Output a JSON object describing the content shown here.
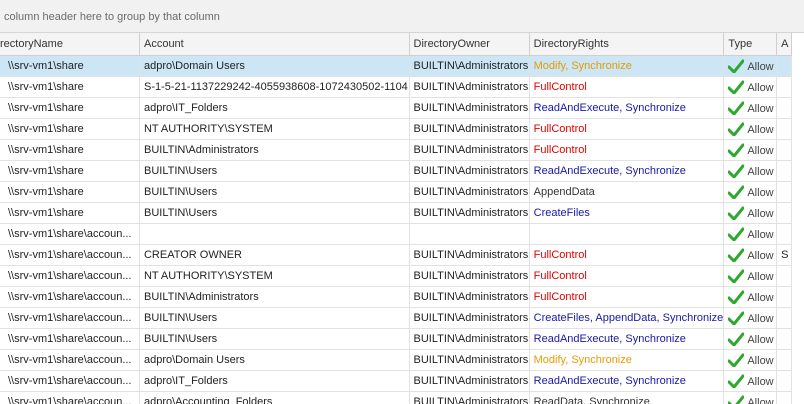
{
  "group_panel": {
    "hint": "column header here to group by that column"
  },
  "columns": [
    "rectoryName",
    "Account",
    "DirectoryOwner",
    "DirectoryRights",
    "Type",
    "A"
  ],
  "colors": {
    "selected_row": "#cce6f5",
    "rights_modify": "#e69a00",
    "rights_full": "#e00000",
    "rights_read": "#1818a8",
    "check": "#2ea82e"
  },
  "rows": [
    {
      "name": "\\\\srv-vm1\\share",
      "account": "adpro\\Domain Users",
      "owner": "BUILTIN\\Administrators",
      "rights": "Modify, Synchronize",
      "rights_kind": "mod",
      "type": "Allow",
      "extra": ""
    },
    {
      "name": "\\\\srv-vm1\\share",
      "account": "S-1-5-21-1137229242-4055938608-1072430502-1104",
      "owner": "BUILTIN\\Administrators",
      "rights": "FullControl",
      "rights_kind": "full",
      "type": "Allow",
      "extra": ""
    },
    {
      "name": "\\\\srv-vm1\\share",
      "account": "adpro\\IT_Folders",
      "owner": "BUILTIN\\Administrators",
      "rights": "ReadAndExecute, Synchronize",
      "rights_kind": "read",
      "type": "Allow",
      "extra": ""
    },
    {
      "name": "\\\\srv-vm1\\share",
      "account": "NT AUTHORITY\\SYSTEM",
      "owner": "BUILTIN\\Administrators",
      "rights": "FullControl",
      "rights_kind": "full",
      "type": "Allow",
      "extra": ""
    },
    {
      "name": "\\\\srv-vm1\\share",
      "account": "BUILTIN\\Administrators",
      "owner": "BUILTIN\\Administrators",
      "rights": "FullControl",
      "rights_kind": "full",
      "type": "Allow",
      "extra": ""
    },
    {
      "name": "\\\\srv-vm1\\share",
      "account": "BUILTIN\\Users",
      "owner": "BUILTIN\\Administrators",
      "rights": "ReadAndExecute, Synchronize",
      "rights_kind": "read",
      "type": "Allow",
      "extra": ""
    },
    {
      "name": "\\\\srv-vm1\\share",
      "account": "BUILTIN\\Users",
      "owner": "BUILTIN\\Administrators",
      "rights": "AppendData",
      "rights_kind": "plain",
      "type": "Allow",
      "extra": ""
    },
    {
      "name": "\\\\srv-vm1\\share",
      "account": "BUILTIN\\Users",
      "owner": "BUILTIN\\Administrators",
      "rights": "CreateFiles",
      "rights_kind": "read",
      "type": "Allow",
      "extra": ""
    },
    {
      "name": "\\\\srv-vm1\\share\\accoun...",
      "account": "",
      "owner": "",
      "rights": "",
      "rights_kind": "plain",
      "type": "Allow",
      "extra": ""
    },
    {
      "name": "\\\\srv-vm1\\share\\accoun...",
      "account": "CREATOR OWNER",
      "owner": "BUILTIN\\Administrators",
      "rights": "FullControl",
      "rights_kind": "full",
      "type": "Allow",
      "extra": "S"
    },
    {
      "name": "\\\\srv-vm1\\share\\accoun...",
      "account": "NT AUTHORITY\\SYSTEM",
      "owner": "BUILTIN\\Administrators",
      "rights": "FullControl",
      "rights_kind": "full",
      "type": "Allow",
      "extra": ""
    },
    {
      "name": "\\\\srv-vm1\\share\\accoun...",
      "account": "BUILTIN\\Administrators",
      "owner": "BUILTIN\\Administrators",
      "rights": "FullControl",
      "rights_kind": "full",
      "type": "Allow",
      "extra": ""
    },
    {
      "name": "\\\\srv-vm1\\share\\accoun...",
      "account": "BUILTIN\\Users",
      "owner": "BUILTIN\\Administrators",
      "rights": "CreateFiles, AppendData, Synchronize",
      "rights_kind": "read",
      "type": "Allow",
      "extra": ""
    },
    {
      "name": "\\\\srv-vm1\\share\\accoun...",
      "account": "BUILTIN\\Users",
      "owner": "BUILTIN\\Administrators",
      "rights": "ReadAndExecute, Synchronize",
      "rights_kind": "read",
      "type": "Allow",
      "extra": ""
    },
    {
      "name": "\\\\srv-vm1\\share\\accoun...",
      "account": "adpro\\Domain Users",
      "owner": "BUILTIN\\Administrators",
      "rights": "Modify, Synchronize",
      "rights_kind": "mod",
      "type": "Allow",
      "extra": ""
    },
    {
      "name": "\\\\srv-vm1\\share\\accoun...",
      "account": "adpro\\IT_Folders",
      "owner": "BUILTIN\\Administrators",
      "rights": "ReadAndExecute, Synchronize",
      "rights_kind": "read",
      "type": "Allow",
      "extra": ""
    },
    {
      "name": "\\\\srv-vm1\\share\\accoun...",
      "account": "adpro\\Accounting_Folders",
      "owner": "BUILTIN\\Administrators",
      "rights": "ReadData, Synchronize",
      "rights_kind": "plain",
      "type": "Allow",
      "extra": ""
    }
  ]
}
